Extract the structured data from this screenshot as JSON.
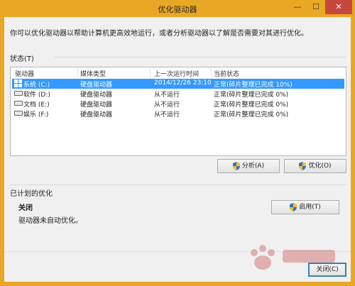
{
  "window": {
    "title": "优化驱动器",
    "controls": {
      "minimize": "—",
      "maximize": "☐",
      "close": "✕"
    }
  },
  "description": "你可以优化驱动器以帮助计算机更高效地运行，或者分析驱动器以了解是否需要对其进行优化。",
  "status": {
    "label": "状态(T)",
    "columns": [
      "驱动器",
      "媒体类型",
      "上一次运行时间",
      "当前状态"
    ],
    "drives": [
      {
        "name": "系统 (C:)",
        "media": "硬盘驱动器",
        "last_run": "2014/12/26 23:10",
        "status": "正常(碎片整理已完成 10%)",
        "icon": "windows-drive-icon",
        "selected": true
      },
      {
        "name": "软件 (D:)",
        "media": "硬盘驱动器",
        "last_run": "从不运行",
        "status": "正常(碎片整理已完成 0%)",
        "icon": "hard-drive-icon",
        "selected": false
      },
      {
        "name": "文档 (E:)",
        "media": "硬盘驱动器",
        "last_run": "从不运行",
        "status": "正常(碎片整理已完成 0%)",
        "icon": "hard-drive-icon",
        "selected": false
      },
      {
        "name": "娱乐 (F:)",
        "media": "硬盘驱动器",
        "last_run": "从不运行",
        "status": "正常(碎片整理已完成 0%)",
        "icon": "hard-drive-icon",
        "selected": false
      }
    ]
  },
  "buttons": {
    "analyze": "分析(A)",
    "optimize": "优化(O)",
    "enable": "启用(T)",
    "close": "关闭(C)"
  },
  "scheduled": {
    "label": "已计划的优化",
    "state": "关闭",
    "note": "驱动器未自动优化。"
  },
  "colors": {
    "frame": "#e9a824",
    "selection": "#3399ff",
    "close_button": "#c7463d"
  }
}
